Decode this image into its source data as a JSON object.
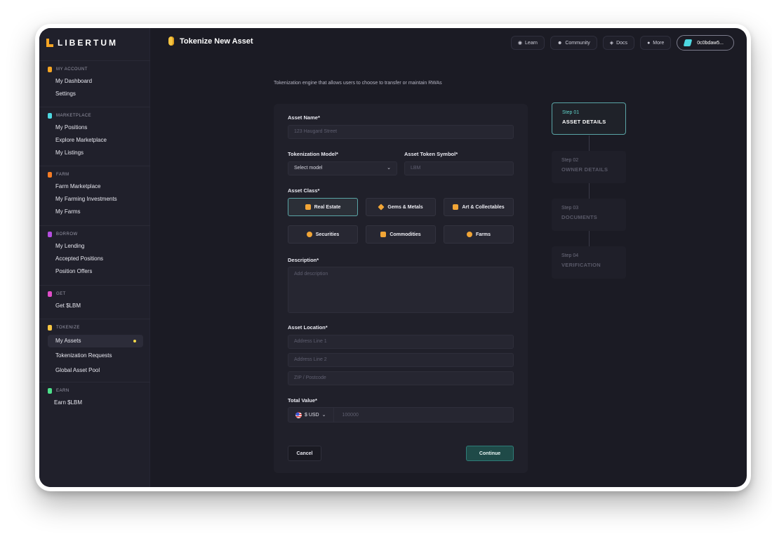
{
  "brand": {
    "name": "LIBERTUM"
  },
  "sidebar": {
    "sections": [
      {
        "label": "MY ACCOUNT",
        "color": "#f5a524",
        "items": [
          "My Dashboard",
          "Settings"
        ]
      },
      {
        "label": "MARKETPLACE",
        "color": "#4dd7e0",
        "items": [
          "My Positions",
          "Explore Marketplace",
          "My Listings"
        ]
      },
      {
        "label": "FARM",
        "color": "#f57c24",
        "items": [
          "Farm Marketplace",
          "My Farming Investments",
          "My Farms"
        ]
      },
      {
        "label": "BORROW",
        "color": "#b44de0",
        "items": [
          "My Lending",
          "Accepted Positions",
          "Position Offers"
        ]
      },
      {
        "label": "GET",
        "color": "#e04dc8",
        "items": [
          "Get $LBM"
        ]
      },
      {
        "label": "TOKENIZE",
        "color": "#f5c542",
        "items": [
          "My Assets",
          "Tokenization Requests",
          "Global Asset Pool"
        ],
        "active": "My Assets"
      },
      {
        "label": "EARN",
        "color": "#4de08a",
        "items": [
          "Earn $LBM"
        ]
      }
    ]
  },
  "header": {
    "title": "Tokenize New Asset",
    "buttons": {
      "learn": "Learn",
      "community": "Community",
      "docs": "Docs",
      "more": "More"
    },
    "wallet": "0c0bdaw5..."
  },
  "intro": "Tokenization engine that allows users to choose to transfer or maintain RWAs",
  "form": {
    "asset_name": {
      "label": "Asset Name*",
      "placeholder": "123 Haugard Street"
    },
    "model": {
      "label": "Tokenization Model*",
      "value": "Select model"
    },
    "symbol": {
      "label": "Asset Token Symbol*",
      "placeholder": "LBM"
    },
    "asset_class": {
      "label": "Asset Class*",
      "options": [
        "Real Estate",
        "Gems & Metals",
        "Art & Collectables",
        "Securities",
        "Commodities",
        "Farms"
      ],
      "selected": "Real Estate"
    },
    "description": {
      "label": "Description*",
      "placeholder": "Add description"
    },
    "location": {
      "label": "Asset Location*",
      "line1": "Address Line 1",
      "line2": "Address Line 2",
      "zip": "ZIP / Postcode"
    },
    "total_value": {
      "label": "Total Value*",
      "currency": "$ USD",
      "placeholder": "100000"
    },
    "cancel": "Cancel",
    "continue": "Continue"
  },
  "steps": [
    {
      "num": "Step 01",
      "title": "ASSET DETAILS",
      "current": true
    },
    {
      "num": "Step 02",
      "title": "OWNER DETAILS"
    },
    {
      "num": "Step 03",
      "title": "DOCUMENTS"
    },
    {
      "num": "Step 04",
      "title": "VERIFICATION"
    }
  ]
}
